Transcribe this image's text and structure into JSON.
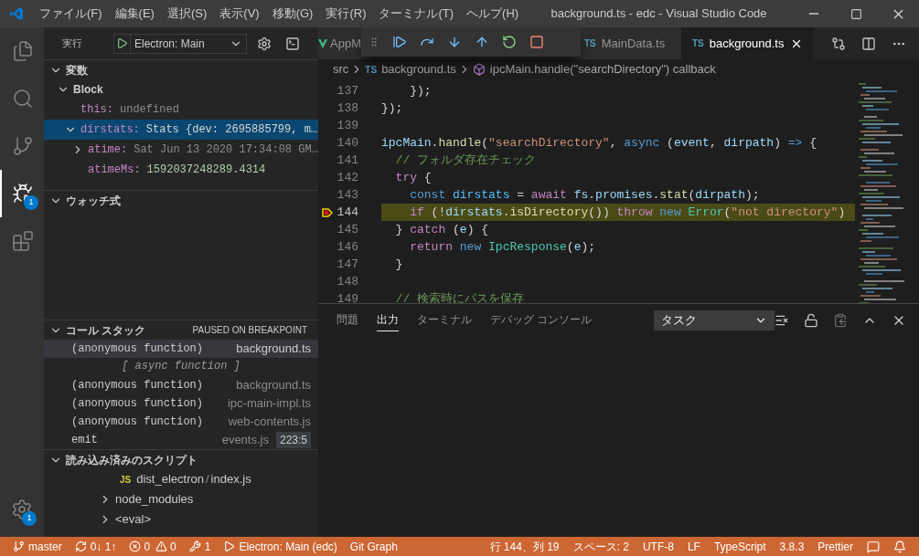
{
  "window": {
    "title": "background.ts - edc - Visual Studio Code"
  },
  "menu": [
    "ファイル(F)",
    "編集(E)",
    "選択(S)",
    "表示(V)",
    "移動(G)",
    "実行(R)",
    "ターミナル(T)",
    "ヘルプ(H)"
  ],
  "activity_bar": [
    {
      "kind": "explorer",
      "selected": false
    },
    {
      "kind": "search",
      "selected": false
    },
    {
      "kind": "source-control",
      "selected": false
    },
    {
      "kind": "debug",
      "selected": true,
      "badge": "1"
    },
    {
      "kind": "extensions",
      "selected": false
    }
  ],
  "activity_bottom": {
    "kind": "settings",
    "badge": "1"
  },
  "sidebar": {
    "title": "実行",
    "config": "Electron: Main",
    "variables": {
      "title": "変数",
      "expanded": true,
      "items": [
        {
          "kind": "scope",
          "name": "Block",
          "expanded": true,
          "selected": false,
          "children": [
            {
              "kind": "leaf",
              "name": "this:",
              "value": "undefined",
              "color": "#8a8a8a",
              "selected": false
            },
            {
              "kind": "node",
              "name": "dirstats:",
              "value": "Stats {dev: 2695885799, m…",
              "color": "#d4d4d4",
              "expanded": true,
              "selected": true,
              "children": [
                {
                  "kind": "node",
                  "name": "atime:",
                  "value": "Sat Jun 13 2020 17:34:08 GM…",
                  "color": "#8b8b8b",
                  "expanded": false,
                  "selected": false
                },
                {
                  "kind": "leaf",
                  "name": "atimeMs:",
                  "value": "1592037248289.4314",
                  "color": "#b5cea8",
                  "selected": false
                }
              ]
            }
          ]
        }
      ]
    },
    "watch": {
      "title": "ウォッチ式",
      "expanded": true
    },
    "call_stack": {
      "title": "コール スタック",
      "status": "PAUSED ON BREAKPOINT",
      "expanded": true,
      "items": [
        {
          "kind": "frame",
          "name": "(anonymous function)",
          "source": "background.ts",
          "selected": true
        },
        {
          "kind": "label",
          "name": "[ async function ]",
          "selected": false
        },
        {
          "kind": "frame",
          "name": "(anonymous function)",
          "source": "background.ts",
          "selected": false
        },
        {
          "kind": "frame",
          "name": "(anonymous function)",
          "source": "ipc-main-impl.ts",
          "selected": false
        },
        {
          "kind": "frame",
          "name": "(anonymous function)",
          "source": "web-contents.js",
          "selected": false
        },
        {
          "kind": "frame",
          "name": "emit",
          "source": "events.js",
          "position": "223:5",
          "selected": false
        }
      ]
    },
    "scripts": {
      "title": "読み込み済みのスクリプト",
      "expanded": true,
      "items": [
        {
          "kind": "file",
          "badge": "JS",
          "folder": "dist_electron",
          "separator": "/",
          "name": "index.js"
        },
        {
          "kind": "folder",
          "name": "node_modules",
          "expanded": false
        },
        {
          "kind": "folder",
          "name": "<eval>",
          "expanded": false
        }
      ]
    }
  },
  "tabs": [
    {
      "label": "AppM",
      "kind": "vue",
      "selected": false
    },
    {
      "label": "MainData.ts",
      "kind": "ts",
      "badge": "TS",
      "selected": false
    },
    {
      "label": "background.ts",
      "kind": "ts",
      "badge": "TS",
      "selected": true
    }
  ],
  "breadcrumb": {
    "folder": "src",
    "badge": "TS",
    "file": "background.ts",
    "symbol": "ipcMain.handle(\"searchDirectory\") callback"
  },
  "debug_toolbar": [
    {
      "kind": "drag"
    },
    {
      "kind": "continue"
    },
    {
      "kind": "step-over"
    },
    {
      "kind": "step-into"
    },
    {
      "kind": "step-out"
    },
    {
      "kind": "restart"
    },
    {
      "kind": "stop"
    }
  ],
  "code": [
    {
      "number": "137",
      "current": false,
      "tokens": [
        {
          "text": "    });",
          "kind": "plain"
        }
      ]
    },
    {
      "number": "138",
      "current": false,
      "tokens": [
        {
          "text": "});",
          "kind": "plain"
        }
      ]
    },
    {
      "number": "139",
      "current": false
    },
    {
      "number": "140",
      "current": false,
      "tokens": [
        {
          "text": "ipcMain",
          "kind": "var"
        },
        {
          "text": ".",
          "kind": "plain"
        },
        {
          "text": "handle",
          "kind": "func"
        },
        {
          "text": "(",
          "kind": "plain"
        },
        {
          "text": "\"searchDirectory\"",
          "kind": "string"
        },
        {
          "text": ", ",
          "kind": "plain"
        },
        {
          "text": "async",
          "kind": "keyword"
        },
        {
          "text": " (",
          "kind": "plain"
        },
        {
          "text": "event",
          "kind": "var"
        },
        {
          "text": ", ",
          "kind": "plain"
        },
        {
          "text": "dirpath",
          "kind": "var"
        },
        {
          "text": ") ",
          "kind": "plain"
        },
        {
          "text": "=>",
          "kind": "keyword"
        },
        {
          "text": " {",
          "kind": "plain"
        }
      ]
    },
    {
      "number": "141",
      "current": false,
      "tokens": [
        {
          "text": "  // フォルダ存在チェック",
          "kind": "comment"
        }
      ]
    },
    {
      "number": "142",
      "current": false,
      "tokens": [
        {
          "text": "  try",
          "kind": "control"
        },
        {
          "text": " {",
          "kind": "plain"
        }
      ]
    },
    {
      "number": "143",
      "current": false,
      "tokens": [
        {
          "text": "    const",
          "kind": "keyword"
        },
        {
          "text": " dirstats",
          "kind": "const"
        },
        {
          "text": " = ",
          "kind": "plain"
        },
        {
          "text": "await",
          "kind": "control"
        },
        {
          "text": " fs",
          "kind": "var"
        },
        {
          "text": ".",
          "kind": "plain"
        },
        {
          "text": "promises",
          "kind": "var"
        },
        {
          "text": ".",
          "kind": "plain"
        },
        {
          "text": "stat",
          "kind": "func"
        },
        {
          "text": "(",
          "kind": "plain"
        },
        {
          "text": "dirpath",
          "kind": "var"
        },
        {
          "text": ");",
          "kind": "plain"
        }
      ]
    },
    {
      "number": "144",
      "current": true,
      "tokens": [
        {
          "text": "    if",
          "kind": "control"
        },
        {
          "text": " (!",
          "kind": "plain"
        },
        {
          "text": "dirstats",
          "kind": "var"
        },
        {
          "text": ".",
          "kind": "plain"
        },
        {
          "text": "isDirectory",
          "kind": "func"
        },
        {
          "text": "()) ",
          "kind": "plain"
        },
        {
          "text": "throw",
          "kind": "control"
        },
        {
          "text": " new",
          "kind": "keyword"
        },
        {
          "text": " Error",
          "kind": "type"
        },
        {
          "text": "(",
          "kind": "plain"
        },
        {
          "text": "\"not directory\"",
          "kind": "string"
        },
        {
          "text": ")",
          "kind": "plain"
        }
      ]
    },
    {
      "number": "145",
      "current": false,
      "tokens": [
        {
          "text": "  } ",
          "kind": "plain"
        },
        {
          "text": "catch",
          "kind": "control"
        },
        {
          "text": " (",
          "kind": "plain"
        },
        {
          "text": "e",
          "kind": "var"
        },
        {
          "text": ") {",
          "kind": "plain"
        }
      ]
    },
    {
      "number": "146",
      "current": false,
      "tokens": [
        {
          "text": "    return",
          "kind": "control"
        },
        {
          "text": " new",
          "kind": "keyword"
        },
        {
          "text": " IpcResponse",
          "kind": "type"
        },
        {
          "text": "(",
          "kind": "plain"
        },
        {
          "text": "e",
          "kind": "var"
        },
        {
          "text": ");",
          "kind": "plain"
        }
      ]
    },
    {
      "number": "147",
      "current": false,
      "tokens": [
        {
          "text": "  }",
          "kind": "plain"
        }
      ]
    },
    {
      "number": "148",
      "current": false
    },
    {
      "number": "149",
      "current": false,
      "tokens": [
        {
          "text": "  // 検索時にパスを保存",
          "kind": "comment"
        }
      ]
    }
  ],
  "panel": {
    "tabs": [
      {
        "label": "問題",
        "selected": false
      },
      {
        "label": "出力",
        "selected": true
      },
      {
        "label": "ターミナル",
        "selected": false
      },
      {
        "label": "デバッグ コンソール",
        "selected": false
      }
    ],
    "channel": "タスク"
  },
  "status_bar": {
    "left": [
      {
        "kind": "branch",
        "text": "master"
      },
      {
        "kind": "sync",
        "text": "0↓ 1↑"
      },
      {
        "kind": "problems",
        "errors": "0",
        "warnings": "0"
      },
      {
        "kind": "tools",
        "text": "1"
      },
      {
        "kind": "debug",
        "text": "Electron: Main (edc)"
      },
      {
        "kind": "plain",
        "text": "Git Graph"
      }
    ],
    "right": [
      {
        "kind": "plain",
        "text": "行 144、列 19"
      },
      {
        "kind": "plain",
        "text": "スペース: 2"
      },
      {
        "kind": "plain",
        "text": "UTF-8"
      },
      {
        "kind": "plain",
        "text": "LF"
      },
      {
        "kind": "plain",
        "text": "TypeScript"
      },
      {
        "kind": "plain",
        "text": "3.8.3"
      },
      {
        "kind": "plain",
        "text": "Prettier"
      },
      {
        "kind": "feedback"
      },
      {
        "kind": "bell"
      }
    ]
  }
}
